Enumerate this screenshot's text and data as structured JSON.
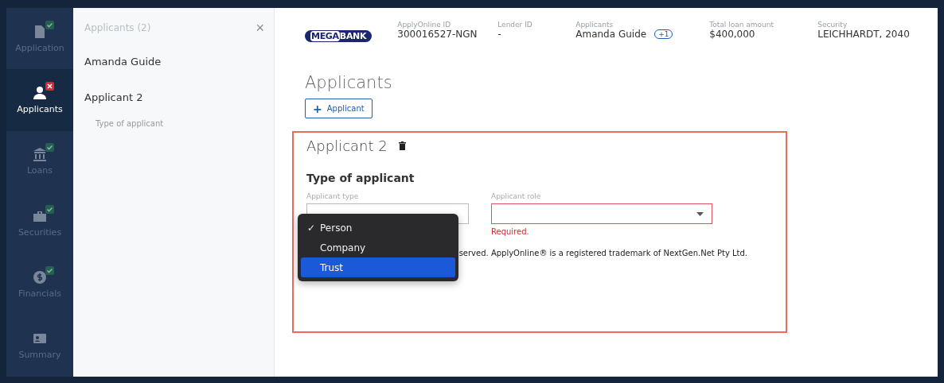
{
  "nav": [
    {
      "label": "Application",
      "kind": "done",
      "selected": false
    },
    {
      "label": "Applicants",
      "kind": "error",
      "selected": true
    },
    {
      "label": "Loans",
      "kind": "done",
      "selected": false
    },
    {
      "label": "Securities",
      "kind": "done",
      "selected": false
    },
    {
      "label": "Financials",
      "kind": "done",
      "selected": false
    },
    {
      "label": "Summary",
      "kind": "plain",
      "selected": false
    }
  ],
  "panel": {
    "title": "Applicants (2)",
    "close": "×",
    "items": [
      {
        "label": "Amanda Guide",
        "kind": "applicant"
      },
      {
        "label": "Applicant 2",
        "kind": "applicant"
      },
      {
        "label": "Type of applicant",
        "kind": "section"
      }
    ]
  },
  "header": {
    "logo": {
      "part1": "MEGA",
      "part2": "BANK"
    },
    "fields": [
      {
        "label": "ApplyOnline ID",
        "value": "300016527-NGN"
      },
      {
        "label": "Lender ID",
        "value": "-"
      },
      {
        "label": "Applicants",
        "value": "Amanda Guide",
        "badge": "+1"
      },
      {
        "label": "Total loan amount",
        "value": "$400,000"
      },
      {
        "label": "Security",
        "value": "LEICHHARDT, 2040"
      }
    ]
  },
  "page_title": "Applicants",
  "add_button": {
    "icon": "+",
    "label": "Applicant"
  },
  "card": {
    "title": "Applicant 2",
    "error": true,
    "section": "Type of applicant",
    "fields": [
      {
        "label": "Applicant type",
        "error": false
      },
      {
        "label": "Applicant role",
        "error": true,
        "message": "Required."
      }
    ],
    "dropdown": [
      {
        "label": "Person",
        "checked": true,
        "highlighted": false
      },
      {
        "label": "Company",
        "checked": false,
        "highlighted": false
      },
      {
        "label": "Trust",
        "checked": false,
        "highlighted": true
      }
    ],
    "check_mark": "✓",
    "footer": "served. ApplyOnline® is a registered trademark of NextGen.Net Pty Ltd."
  }
}
